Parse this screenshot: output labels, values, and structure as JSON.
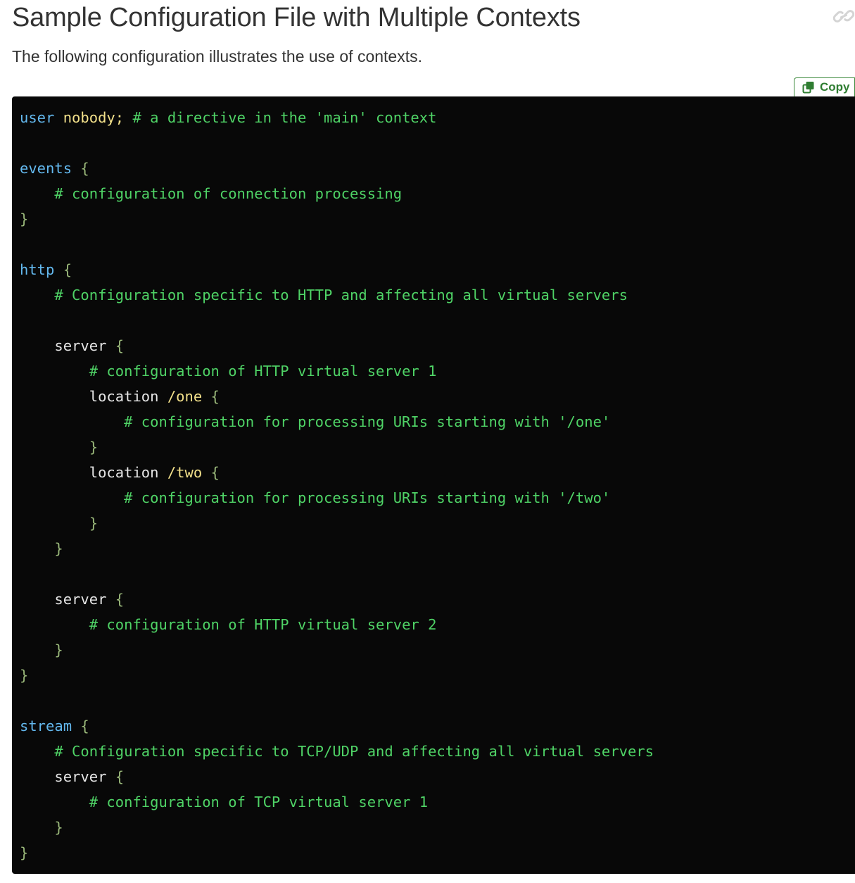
{
  "page": {
    "title": "Sample Configuration File with Multiple Contexts",
    "subtitle": "The following configuration illustrates the use of contexts."
  },
  "toolbar": {
    "copy_label": "Copy",
    "copy_icon": "copy-icon",
    "permalink_icon": "link-icon"
  },
  "colors": {
    "code_background": "#080808",
    "keyword": "#63b8ee",
    "value": "#f2e08a",
    "comment": "#4fd366",
    "plain": "#e6e6e6",
    "brace": "#9ab87a",
    "accent": "#2f7d32"
  },
  "code": {
    "lines": [
      [
        {
          "t": "user",
          "k": "keyword"
        },
        {
          "t": " ",
          "k": "plain"
        },
        {
          "t": "nobody;",
          "k": "value"
        },
        {
          "t": " # a directive in the 'main' context",
          "k": "comment"
        }
      ],
      [],
      [
        {
          "t": "events",
          "k": "keyword"
        },
        {
          "t": " {",
          "k": "brace"
        }
      ],
      [
        {
          "t": "    ",
          "k": "plain"
        },
        {
          "t": "# configuration of connection processing",
          "k": "comment"
        }
      ],
      [
        {
          "t": "}",
          "k": "brace"
        }
      ],
      [],
      [
        {
          "t": "http",
          "k": "keyword"
        },
        {
          "t": " {",
          "k": "brace"
        }
      ],
      [
        {
          "t": "    ",
          "k": "plain"
        },
        {
          "t": "# Configuration specific to HTTP and affecting all virtual servers",
          "k": "comment"
        }
      ],
      [],
      [
        {
          "t": "    ",
          "k": "plain"
        },
        {
          "t": "server",
          "k": "plain"
        },
        {
          "t": " {",
          "k": "brace"
        }
      ],
      [
        {
          "t": "        ",
          "k": "plain"
        },
        {
          "t": "# configuration of HTTP virtual server 1",
          "k": "comment"
        }
      ],
      [
        {
          "t": "        ",
          "k": "plain"
        },
        {
          "t": "location",
          "k": "plain"
        },
        {
          "t": " ",
          "k": "plain"
        },
        {
          "t": "/one",
          "k": "value"
        },
        {
          "t": " {",
          "k": "brace"
        }
      ],
      [
        {
          "t": "            ",
          "k": "plain"
        },
        {
          "t": "# configuration for processing URIs starting with '/one'",
          "k": "comment"
        }
      ],
      [
        {
          "t": "        ",
          "k": "plain"
        },
        {
          "t": "}",
          "k": "brace"
        }
      ],
      [
        {
          "t": "        ",
          "k": "plain"
        },
        {
          "t": "location",
          "k": "plain"
        },
        {
          "t": " ",
          "k": "plain"
        },
        {
          "t": "/two",
          "k": "value"
        },
        {
          "t": " {",
          "k": "brace"
        }
      ],
      [
        {
          "t": "            ",
          "k": "plain"
        },
        {
          "t": "# configuration for processing URIs starting with '/two'",
          "k": "comment"
        }
      ],
      [
        {
          "t": "        ",
          "k": "plain"
        },
        {
          "t": "}",
          "k": "brace"
        }
      ],
      [
        {
          "t": "    ",
          "k": "plain"
        },
        {
          "t": "}",
          "k": "brace"
        }
      ],
      [],
      [
        {
          "t": "    ",
          "k": "plain"
        },
        {
          "t": "server",
          "k": "plain"
        },
        {
          "t": " {",
          "k": "brace"
        }
      ],
      [
        {
          "t": "        ",
          "k": "plain"
        },
        {
          "t": "# configuration of HTTP virtual server 2",
          "k": "comment"
        }
      ],
      [
        {
          "t": "    ",
          "k": "plain"
        },
        {
          "t": "}",
          "k": "brace"
        }
      ],
      [
        {
          "t": "}",
          "k": "brace"
        }
      ],
      [],
      [
        {
          "t": "stream",
          "k": "keyword"
        },
        {
          "t": " {",
          "k": "brace"
        }
      ],
      [
        {
          "t": "    ",
          "k": "plain"
        },
        {
          "t": "# Configuration specific to TCP/UDP and affecting all virtual servers",
          "k": "comment"
        }
      ],
      [
        {
          "t": "    ",
          "k": "plain"
        },
        {
          "t": "server",
          "k": "plain"
        },
        {
          "t": " {",
          "k": "brace"
        }
      ],
      [
        {
          "t": "        ",
          "k": "plain"
        },
        {
          "t": "# configuration of TCP virtual server 1",
          "k": "comment"
        }
      ],
      [
        {
          "t": "    ",
          "k": "plain"
        },
        {
          "t": "}",
          "k": "brace"
        }
      ],
      [
        {
          "t": "}",
          "k": "brace"
        }
      ]
    ]
  }
}
